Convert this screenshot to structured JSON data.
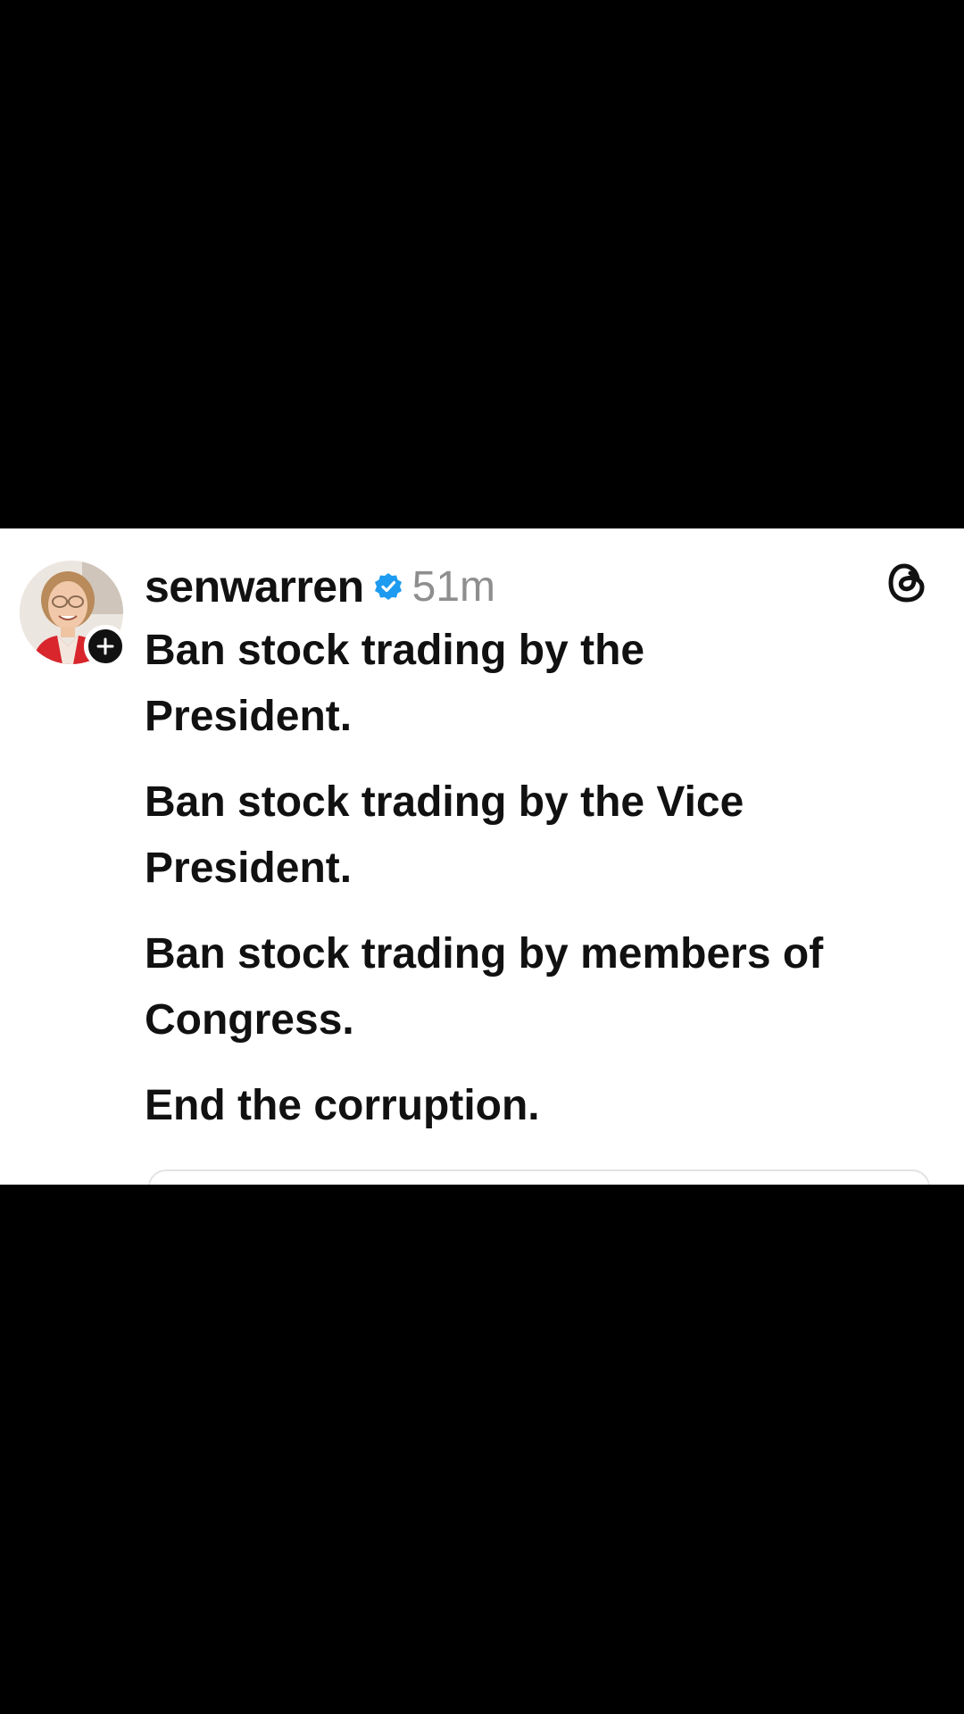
{
  "post": {
    "username": "senwarren",
    "timestamp": "51m",
    "verified": true,
    "paragraphs": [
      "Ban stock trading by the\nPresident.",
      "Ban stock trading by the Vice\nPresident.",
      "Ban stock trading by members of\nCongress.",
      "End the corruption."
    ]
  },
  "icons": {
    "verified": "verified-badge-icon",
    "follow": "plus-icon",
    "app": "threads-logo-icon"
  },
  "colors": {
    "background": "#000000",
    "card": "#ffffff",
    "text": "#111111",
    "muted": "#8e8e8e",
    "verified_blue": "#1d9bf0",
    "jacket_red": "#d8262c"
  }
}
